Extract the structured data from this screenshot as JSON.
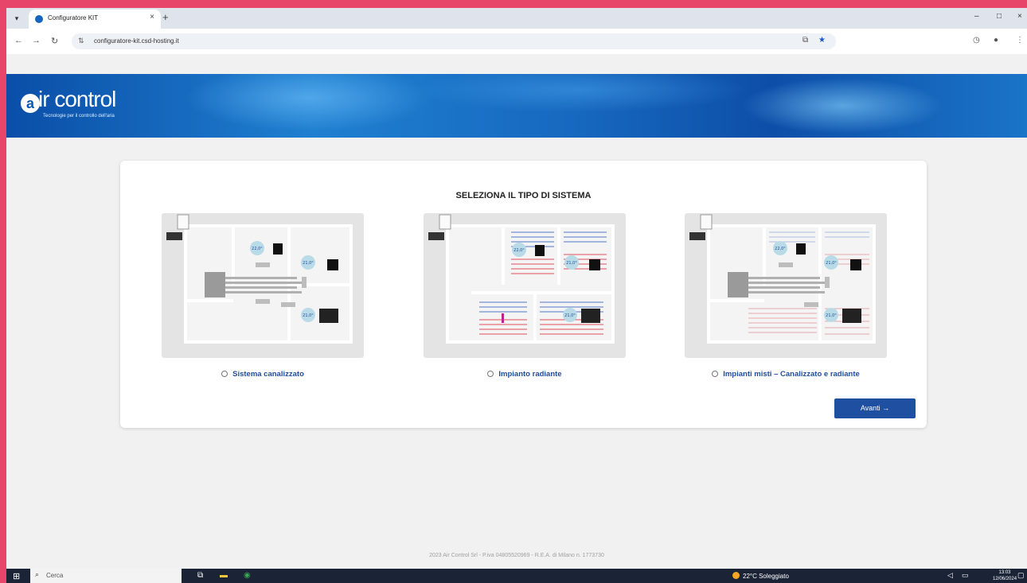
{
  "browser": {
    "tab_title": "Configuratore KIT",
    "tab_close": "×",
    "new_tab": "+",
    "url": "configuratore-kit.csd-hosting.it",
    "minimize": "–",
    "maximize": "□",
    "close": "×"
  },
  "header": {
    "logo_mark": "a",
    "logo_text": "ir control",
    "tagline": "Tecnologie per il controllo dell'aria"
  },
  "main": {
    "title": "SELEZIONA IL TIPO DI SISTEMA",
    "options": [
      {
        "label": "Sistema canalizzato",
        "selected": false,
        "temps": [
          "22,0°",
          "21,0°",
          "21,0°"
        ]
      },
      {
        "label": "Impianto radiante",
        "selected": false,
        "temps": [
          "22,0°",
          "21,0°",
          "21,0°"
        ]
      },
      {
        "label": "Impianti misti – Canalizzato e radiante",
        "selected": false,
        "temps": [
          "22,0°",
          "21,0°",
          "21,0°"
        ]
      }
    ],
    "next_button": "Avanti →"
  },
  "footer": {
    "text": "2023 Air Control Srl - P.iva 04805520969 - R.E.A. di Milano n. 1773730"
  },
  "taskbar": {
    "search_placeholder": "Cerca",
    "weather": "22°C Soleggiato",
    "time": "13:03",
    "date": "12/06/2024"
  },
  "colors": {
    "accent": "#1e4fa1",
    "frame": "#e8456a",
    "banner": "#1769c0"
  }
}
